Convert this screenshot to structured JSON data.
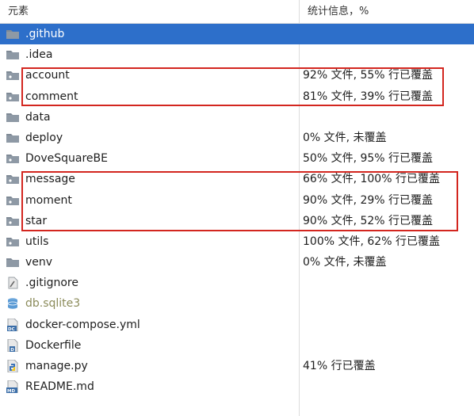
{
  "header": {
    "col_element": "元素",
    "col_stats": "统计信息，%"
  },
  "rows": [
    {
      "name": "github",
      "label": ".github",
      "icon": "folder-icon",
      "stat": "",
      "selected": true
    },
    {
      "name": "idea",
      "label": ".idea",
      "icon": "folder-icon",
      "stat": ""
    },
    {
      "name": "account",
      "label": "account",
      "icon": "package-folder-icon",
      "stat": "92% 文件, 55% 行已覆盖"
    },
    {
      "name": "comment",
      "label": "comment",
      "icon": "package-folder-icon",
      "stat": "81% 文件, 39% 行已覆盖"
    },
    {
      "name": "data",
      "label": "data",
      "icon": "folder-icon",
      "stat": ""
    },
    {
      "name": "deploy",
      "label": "deploy",
      "icon": "folder-icon",
      "stat": "0% 文件, 未覆盖"
    },
    {
      "name": "dovesquarebe",
      "label": "DoveSquareBE",
      "icon": "package-folder-icon",
      "stat": "50% 文件, 95% 行已覆盖"
    },
    {
      "name": "message",
      "label": "message",
      "icon": "package-folder-icon",
      "stat": "66% 文件, 100% 行已覆盖"
    },
    {
      "name": "moment",
      "label": "moment",
      "icon": "package-folder-icon",
      "stat": "90% 文件, 29% 行已覆盖"
    },
    {
      "name": "star",
      "label": "star",
      "icon": "package-folder-icon",
      "stat": "90% 文件, 52% 行已覆盖"
    },
    {
      "name": "utils",
      "label": "utils",
      "icon": "package-folder-icon",
      "stat": "100% 文件, 62% 行已覆盖"
    },
    {
      "name": "venv",
      "label": "venv",
      "icon": "folder-icon",
      "stat": "0% 文件, 未覆盖"
    },
    {
      "name": "gitignore",
      "label": ".gitignore",
      "icon": "gitignore-file-icon",
      "stat": ""
    },
    {
      "name": "db-sqlite3",
      "label": "db.sqlite3",
      "icon": "database-icon",
      "stat": "",
      "dim": true
    },
    {
      "name": "docker-compose",
      "label": "docker-compose.yml",
      "icon": "docker-compose-file-icon",
      "stat": ""
    },
    {
      "name": "dockerfile",
      "label": "Dockerfile",
      "icon": "dockerfile-icon",
      "stat": ""
    },
    {
      "name": "manage-py",
      "label": "manage.py",
      "icon": "python-file-icon",
      "stat": "41% 行已覆盖"
    },
    {
      "name": "readme",
      "label": "README.md",
      "icon": "markdown-file-icon",
      "stat": ""
    }
  ],
  "colors": {
    "selection": "#2d6fca",
    "highlight_box": "#d3261f",
    "folder": "#7f8a96"
  }
}
